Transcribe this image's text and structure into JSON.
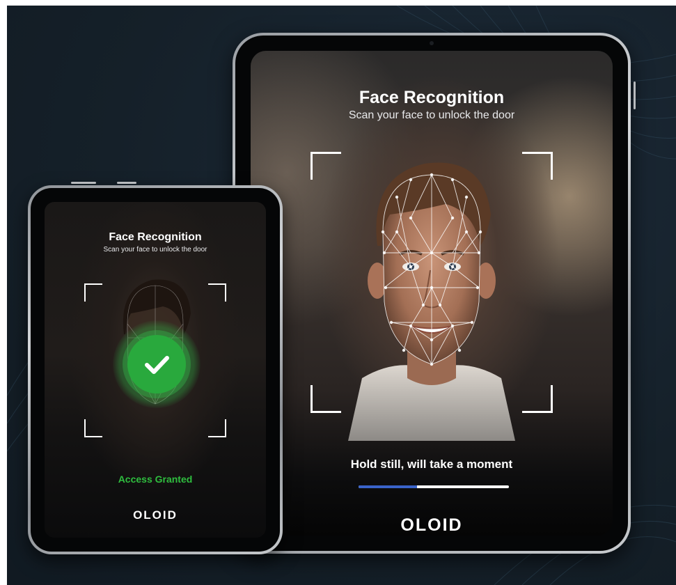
{
  "large_tablet": {
    "title": "Face Recognition",
    "subtitle": "Scan your face to unlock the door",
    "status": "Hold still, will take a moment",
    "progress": 0.39,
    "brand": "OLOID"
  },
  "small_tablet": {
    "title": "Face Recognition",
    "subtitle": "Scan your face to unlock the door",
    "status": "Access Granted",
    "brand": "OLOID"
  },
  "icons": {
    "check": "check-icon",
    "face_mesh": "face-mesh-icon",
    "scan_frame": "scan-frame-icon"
  },
  "colors": {
    "background": "#152029",
    "success_green": "#29a93d",
    "access_text": "#2fbe3f",
    "progress_fill": "#3a63c9",
    "progress_track": "#ffffff"
  }
}
